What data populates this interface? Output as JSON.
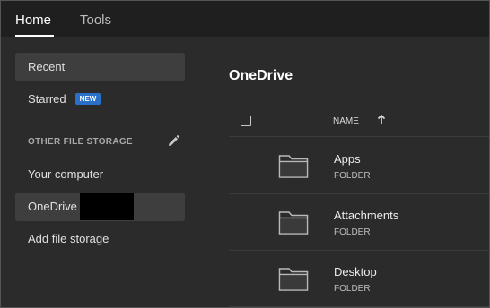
{
  "tabs": {
    "home": "Home",
    "tools": "Tools"
  },
  "sidebar": {
    "recent": "Recent",
    "starred": "Starred",
    "new_badge": "NEW",
    "section_heading": "OTHER FILE STORAGE",
    "your_computer": "Your computer",
    "onedrive": "OneDrive",
    "add_storage": "Add file storage"
  },
  "main": {
    "title": "OneDrive",
    "column_name": "NAME",
    "rows": [
      {
        "name": "Apps",
        "type": "FOLDER"
      },
      {
        "name": "Attachments",
        "type": "FOLDER"
      },
      {
        "name": "Desktop",
        "type": "FOLDER"
      }
    ]
  },
  "colors": {
    "background": "#2b2b2b",
    "topbar": "#1f1f1f",
    "selected": "#3e3e3e",
    "badge": "#2a70c9"
  }
}
